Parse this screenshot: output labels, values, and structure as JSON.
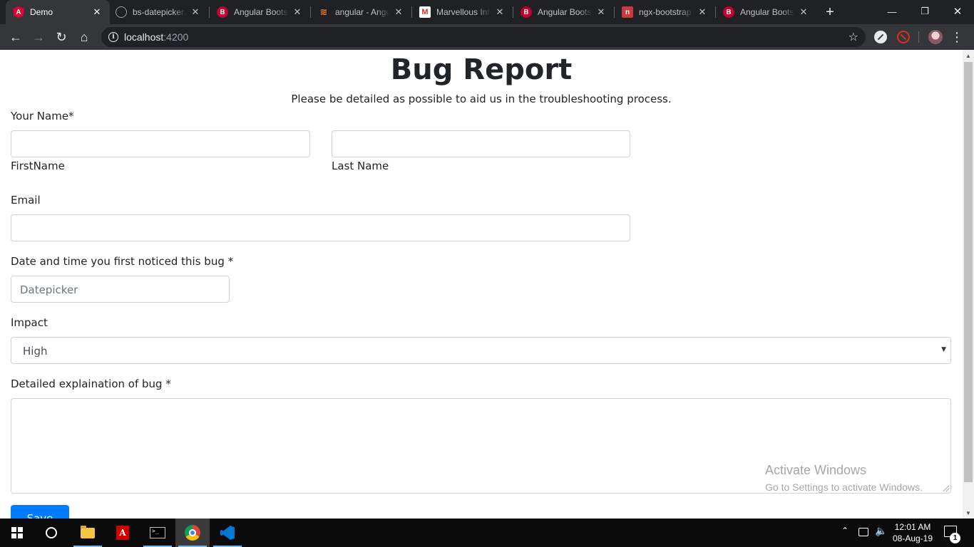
{
  "browser": {
    "tabs": [
      {
        "title": "Demo",
        "icon": "angular-icon"
      },
      {
        "title": "bs-datepicker.c",
        "icon": "globe-icon"
      },
      {
        "title": "Angular Bootst",
        "icon": "bootstrap-icon"
      },
      {
        "title": "angular - Angu",
        "icon": "stackoverflow-icon"
      },
      {
        "title": "Marvellous Info",
        "icon": "gmail-icon"
      },
      {
        "title": "Angular Bootst",
        "icon": "bootstrap-icon"
      },
      {
        "title": "ngx-bootstrap",
        "icon": "npm-icon"
      },
      {
        "title": "Angular Bootst",
        "icon": "bootstrap-icon"
      }
    ],
    "address": {
      "host": "localhost",
      "port": ":4200"
    }
  },
  "page": {
    "title": "Bug Report",
    "subtitle": "Please be detailed as possible to aid us in the troubleshooting process.",
    "name_label": "Your Name*",
    "first_name_caption": "FirstName",
    "last_name_caption": "Last Name",
    "email_label": "Email",
    "date_label": "Date and time you first noticed this bug *",
    "date_placeholder": "Datepicker",
    "impact_label": "Impact",
    "impact_value": "High",
    "details_label": "Detailed explaination of bug *",
    "save_label": "Save"
  },
  "watermark": {
    "line1": "Activate Windows",
    "line2": "Go to Settings to activate Windows."
  },
  "taskbar": {
    "time": "12:01 AM",
    "date": "08-Aug-19",
    "notification_count": "1"
  },
  "colors": {
    "primary": "#007bff",
    "chrome_frame": "#202124",
    "toolbar": "#35363a"
  }
}
